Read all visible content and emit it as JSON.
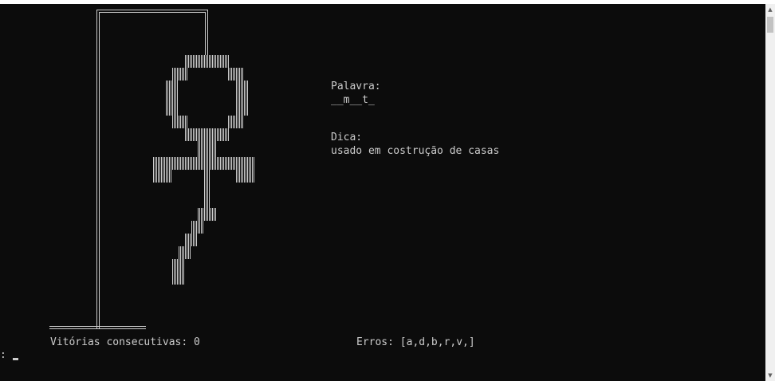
{
  "console": {
    "word_label": "Palavra:",
    "word_pattern": "__m__t_",
    "hint_label": "Dica:",
    "hint_text": "usado em costrução de casas",
    "wins_label": "Vitórias consecutivas: 0",
    "errors_label": "Erros: [a,d,b,r,v,]",
    "prompt": ":"
  },
  "scrollbar": {
    "up_glyph": "▲",
    "down_glyph": "▼"
  },
  "colors": {
    "background": "#0c0c0c",
    "foreground": "#cccccc"
  }
}
